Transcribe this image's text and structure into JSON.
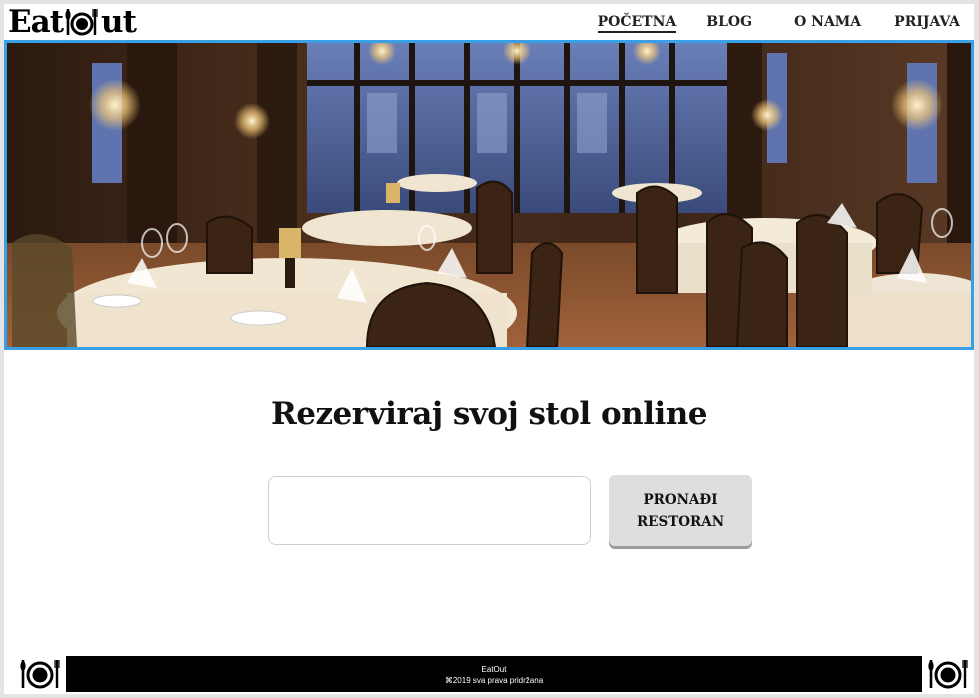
{
  "header": {
    "logo": {
      "part1": "Eat",
      "part2": "ut"
    },
    "nav": [
      {
        "label": "POČETNA",
        "active": true
      },
      {
        "label": "BLOG",
        "active": false
      },
      {
        "label": "O NAMA",
        "active": false
      },
      {
        "label": "PRIJAVA",
        "active": false
      }
    ]
  },
  "hero": {
    "accent_border": "#3aa0e6"
  },
  "main": {
    "headline": "Rezerviraj svoj stol online",
    "search": {
      "value": "",
      "placeholder": ""
    },
    "find_button": "PRONAĐI\nRESTORAN"
  },
  "footer": {
    "brand": "EatOut",
    "copyright": "⌘2019 sva prava pridržana"
  },
  "icons": {
    "logo_icon": "plate-cutlery-icon",
    "footer_left": "plate-cutlery-icon",
    "footer_right": "plate-cutlery-icon"
  }
}
